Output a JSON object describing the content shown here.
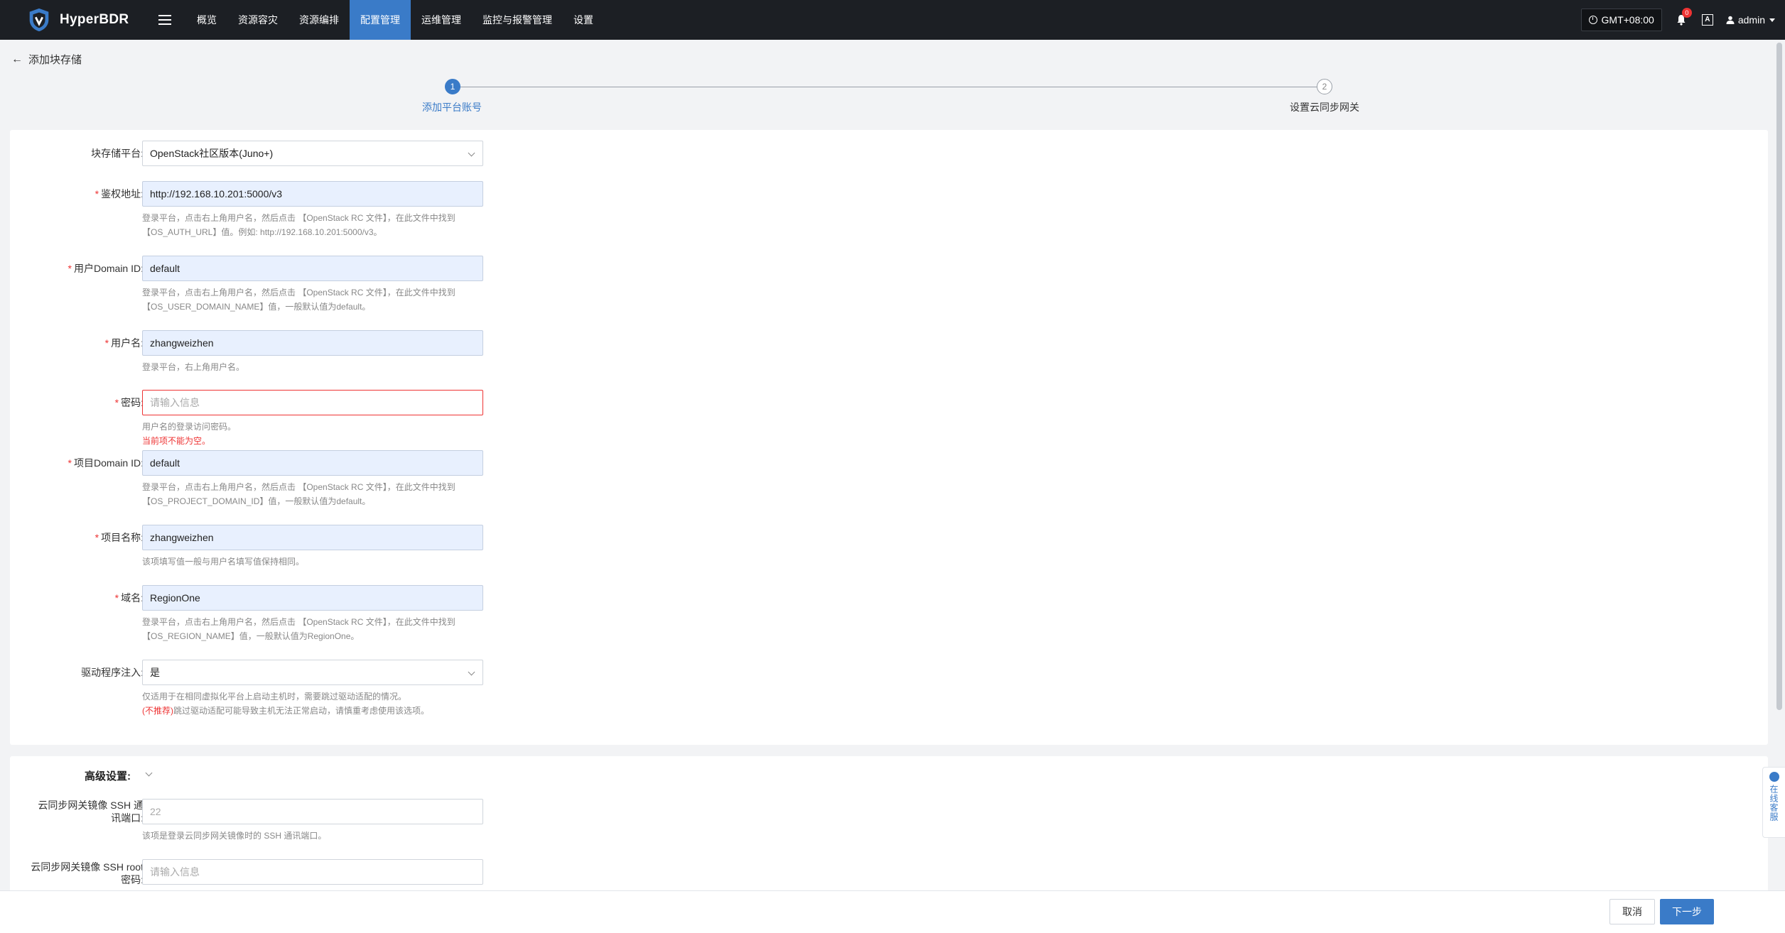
{
  "app": {
    "name": "HyperBDR"
  },
  "nav": {
    "items": [
      {
        "label": "概览",
        "active": false
      },
      {
        "label": "资源容灾",
        "active": false
      },
      {
        "label": "资源编排",
        "active": false
      },
      {
        "label": "配置管理",
        "active": true
      },
      {
        "label": "运维管理",
        "active": false
      },
      {
        "label": "监控与报警管理",
        "active": false
      },
      {
        "label": "设置",
        "active": false
      }
    ],
    "timezone": "GMT+08:00",
    "notification_count": "0",
    "lang_icon": "A",
    "user": "admin"
  },
  "page": {
    "back_label": "添加块存储"
  },
  "steps": [
    {
      "index": "1",
      "label": "添加平台账号"
    },
    {
      "index": "2",
      "label": "设置云同步网关"
    }
  ],
  "form": {
    "platform": {
      "label": "块存储平台:",
      "value": "OpenStack社区版本(Juno+)"
    },
    "auth_url": {
      "label": "鉴权地址:",
      "value": "http://192.168.10.201:5000/v3",
      "hint1": "登录平台，点击右上角用户名，然后点击 【OpenStack RC 文件】，在此文件中找到",
      "hint2": "【OS_AUTH_URL】值。例如: http://192.168.10.201:5000/v3。"
    },
    "user_domain": {
      "label": "用户Domain ID:",
      "value": "default",
      "hint1": "登录平台，点击右上角用户名，然后点击 【OpenStack RC 文件】，在此文件中找到",
      "hint2": "【OS_USER_DOMAIN_NAME】值，一般默认值为default。"
    },
    "username": {
      "label": "用户名:",
      "value": "zhangweizhen",
      "hint1": "登录平台，右上角用户名。"
    },
    "password": {
      "label": "密码:",
      "placeholder": "请输入信息",
      "hint1": "用户名的登录访问密码。",
      "error": "当前项不能为空。"
    },
    "project_domain": {
      "label": "项目Domain ID:",
      "value": "default",
      "hint1": "登录平台，点击右上角用户名，然后点击 【OpenStack RC 文件】，在此文件中找到",
      "hint2": "【OS_PROJECT_DOMAIN_ID】值，一般默认值为default。"
    },
    "project_name": {
      "label": "项目名称:",
      "value": "zhangweizhen",
      "hint1": "该项填写值一般与用户名填写值保持相同。"
    },
    "region": {
      "label": "域名:",
      "value": "RegionOne",
      "hint1": "登录平台，点击右上角用户名，然后点击 【OpenStack RC 文件】，在此文件中找到",
      "hint2": "【OS_REGION_NAME】值，一般默认值为RegionOne。"
    },
    "driver_inject": {
      "label": "驱动程序注入:",
      "value": "是",
      "hint1": "仅适用于在相同虚拟化平台上启动主机时，需要跳过驱动适配的情况。",
      "hint2_red": "(不推荐)",
      "hint2_rest": "跳过驱动适配可能导致主机无法正常启动，请慎重考虑使用该选项。"
    }
  },
  "advanced": {
    "title": "高级设置:",
    "ssh_port": {
      "label_line1": "云同步网关镜像 SSH 通",
      "label_line2": "讯端口:",
      "placeholder": "22",
      "hint1": "该项是登录云同步网关镜像时的 SSH 通讯端口。"
    },
    "ssh_password": {
      "label_line1": "云同步网关镜像 SSH root",
      "label_line2": "密码:",
      "placeholder": "请输入信息"
    }
  },
  "service": {
    "label": "在线客服"
  },
  "footer": {
    "cancel": "取消",
    "next": "下一步"
  },
  "colors": {
    "primary": "#3a7bc8",
    "topbar": "#1c1f24",
    "error": "#e33333"
  }
}
